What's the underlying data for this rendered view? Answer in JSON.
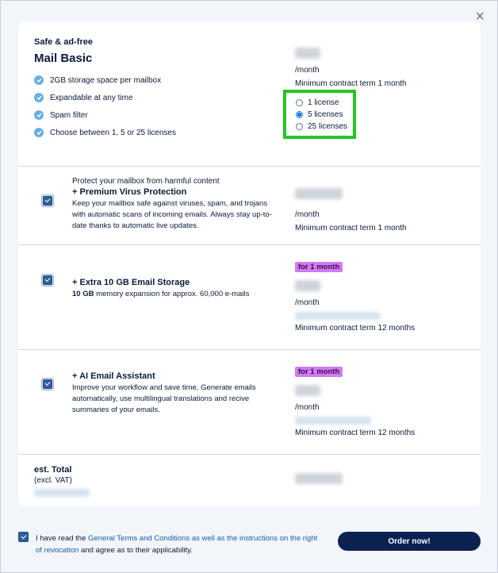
{
  "close_label": "×",
  "plan": {
    "subtitle": "Safe & ad-free",
    "title": "Mail Basic",
    "features": [
      "2GB storage space per mailbox",
      "Expandable at any time",
      "Spam filter",
      "Choose between 1, 5 or 25 licenses"
    ],
    "per_month": "/month",
    "min_term": "Minimum contract term 1 month",
    "license_options": [
      {
        "label": "1 license",
        "selected": false
      },
      {
        "label": "5 licenses",
        "selected": true
      },
      {
        "label": "25 licenses",
        "selected": false
      }
    ]
  },
  "addons": [
    {
      "kicker": "Protect your mailbox from harmful content",
      "title": "+ Premium Virus Protection",
      "desc": "Keep your mailbox safe against viruses, spam, and trojans with automatic scans of incoming emails. Always stay up-to-date thanks to automatic live updates.",
      "per_month": "/month",
      "min_term": "Minimum contract term 1 month",
      "checked": true
    },
    {
      "badge": "for 1 month",
      "title": "+ Extra 10 GB Email Storage",
      "desc_bold": "10 GB",
      "desc": " memory expansion for approx. 60,000 e-mails",
      "per_month": "/month",
      "min_term": "Minimum contract term 12 months",
      "checked": true
    },
    {
      "badge": "for 1 month",
      "title": "+ AI Email Assistant",
      "desc": "Improve your workflow and save time. Generate emails automatically, use multilingual translations and recive summaries of your emails.",
      "per_month": "/month",
      "min_term": "Minimum contract term 12 months",
      "checked": true
    }
  ],
  "total": {
    "label": "est. Total",
    "sub": "(excl. VAT)"
  },
  "footer": {
    "pre": "I have read the ",
    "link": "General Terms and Conditions as well as the instructions on the right of revocation",
    "post": " and agree as to their applicability.",
    "checked": true
  },
  "order_button": "Order now!",
  "colors": {
    "accent": "#0b2151",
    "highlight": "#22c722",
    "badge": "#d07bf0",
    "link": "#1a5fa6"
  }
}
